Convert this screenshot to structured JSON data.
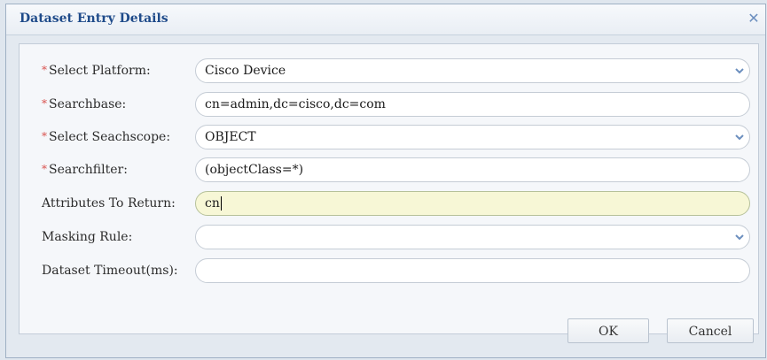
{
  "dialog": {
    "title": "Dataset Entry Details",
    "close_icon": "close-icon"
  },
  "form": {
    "required_marker": "*",
    "rows": [
      {
        "label": "Select Platform:",
        "required": true,
        "type": "select",
        "value": "Cisco Device"
      },
      {
        "label": "Searchbase:",
        "required": true,
        "type": "text",
        "value": "cn=admin,dc=cisco,dc=com"
      },
      {
        "label": "Select Seachscope:",
        "required": true,
        "type": "select",
        "value": "OBJECT"
      },
      {
        "label": "Searchfilter:",
        "required": true,
        "type": "text",
        "value": "(objectClass=*)"
      },
      {
        "label": "Attributes To Return:",
        "required": false,
        "type": "text",
        "value": "cn",
        "focused": true
      },
      {
        "label": "Masking Rule:",
        "required": false,
        "type": "select",
        "value": ""
      },
      {
        "label": "Dataset Timeout(ms):",
        "required": false,
        "type": "text",
        "value": ""
      }
    ]
  },
  "buttons": {
    "ok_label": "OK",
    "cancel_label": "Cancel"
  },
  "colors": {
    "title": "#1f4b8a",
    "required": "#d9534f",
    "focus_field": "#f7f7d6",
    "dropdown_arrow": "#6c8fbf"
  }
}
